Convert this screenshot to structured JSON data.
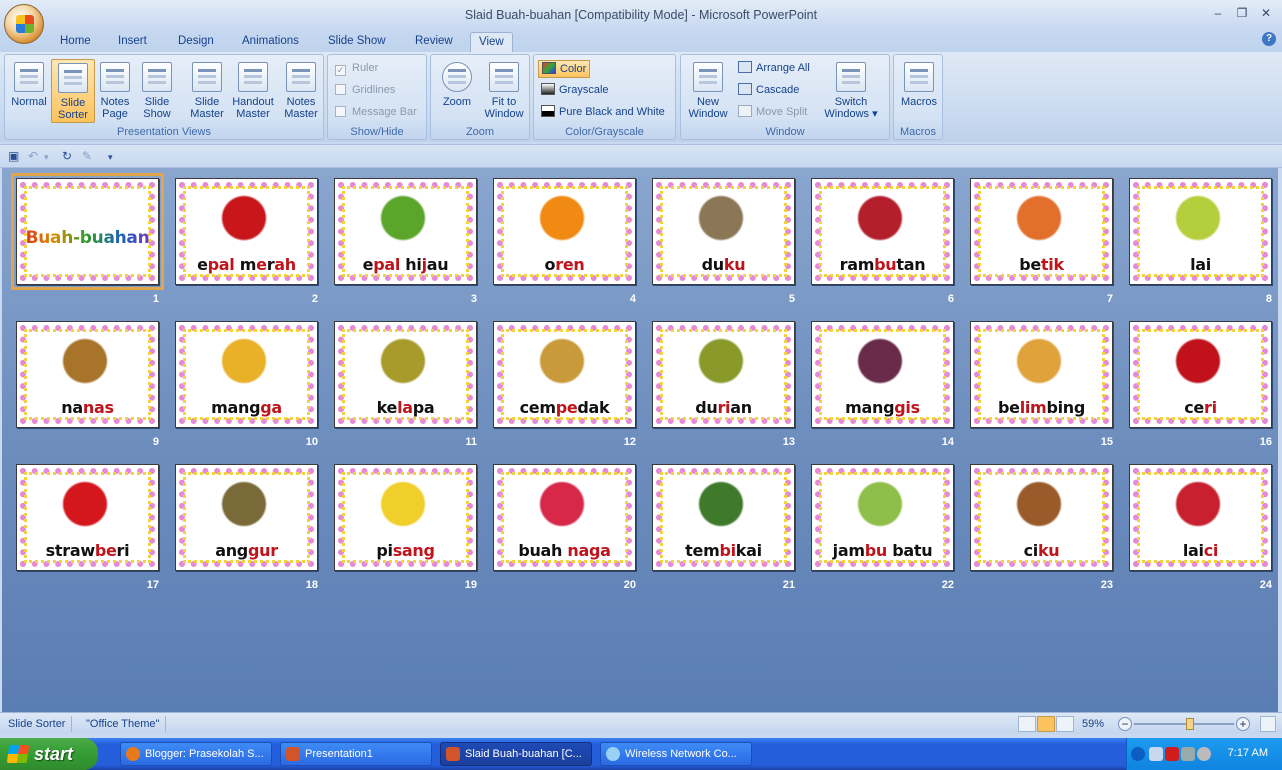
{
  "window": {
    "title": "Slaid Buah-buahan [Compatibility Mode] - Microsoft PowerPoint"
  },
  "tabs": [
    {
      "label": "Home"
    },
    {
      "label": "Insert"
    },
    {
      "label": "Design"
    },
    {
      "label": "Animations"
    },
    {
      "label": "Slide Show"
    },
    {
      "label": "Review"
    },
    {
      "label": "View"
    }
  ],
  "ribbon": {
    "presentation_views": {
      "label": "Presentation Views",
      "normal": "Normal",
      "slide_sorter": "Slide Sorter",
      "notes_page": "Notes Page",
      "slide_show": "Slide Show",
      "slide_master": "Slide Master",
      "handout_master": "Handout Master",
      "notes_master": "Notes Master"
    },
    "show_hide": {
      "label": "Show/Hide",
      "ruler": "Ruler",
      "gridlines": "Gridlines",
      "message_bar": "Message Bar"
    },
    "zoom": {
      "label": "Zoom",
      "zoom": "Zoom",
      "fit": "Fit to Window"
    },
    "color": {
      "label": "Color/Grayscale",
      "color": "Color",
      "grayscale": "Grayscale",
      "pure": "Pure Black and White"
    },
    "window": {
      "label": "Window",
      "new_window": "New Window",
      "arrange_all": "Arrange All",
      "cascade": "Cascade",
      "move_split": "Move Split",
      "switch_windows": "Switch Windows"
    },
    "macros": {
      "label": "Macros",
      "macros": "Macros"
    }
  },
  "slides": [
    {
      "n": "1",
      "title": "Buah-buahan"
    },
    {
      "n": "2",
      "parts": [
        "e",
        "pal ",
        "m",
        "e",
        "r",
        "ah"
      ],
      "pic": "#c8161b"
    },
    {
      "n": "3",
      "parts": [
        "e",
        "pal ",
        "hi",
        "j",
        "au"
      ],
      "pic": "#5aa52a"
    },
    {
      "n": "4",
      "parts": [
        "o",
        "ren"
      ],
      "pic": "#f08a12"
    },
    {
      "n": "5",
      "parts": [
        "du",
        "ku"
      ],
      "pic": "#8b7755"
    },
    {
      "n": "6",
      "parts": [
        "ram",
        "bu",
        "tan"
      ],
      "pic": "#b3202b"
    },
    {
      "n": "7",
      "parts": [
        "be",
        "tik"
      ],
      "pic": "#e2702c"
    },
    {
      "n": "8",
      "parts": [
        "lai"
      ],
      "pic": "#b5cf3c"
    },
    {
      "n": "9",
      "parts": [
        "na",
        "nas"
      ],
      "pic": "#a8742a"
    },
    {
      "n": "10",
      "parts": [
        "mang",
        "ga"
      ],
      "pic": "#e9b128"
    },
    {
      "n": "11",
      "parts": [
        "ke",
        "la",
        "pa"
      ],
      "pic": "#a99a2c"
    },
    {
      "n": "12",
      "parts": [
        "cem",
        "pe",
        "dak"
      ],
      "pic": "#c99a3a"
    },
    {
      "n": "13",
      "parts": [
        "du",
        "ri",
        "an"
      ],
      "pic": "#8a9a2a"
    },
    {
      "n": "14",
      "parts": [
        "mang",
        "gis"
      ],
      "pic": "#6a2a4a"
    },
    {
      "n": "15",
      "parts": [
        "be",
        "lim",
        "bing"
      ],
      "pic": "#e0a23a"
    },
    {
      "n": "16",
      "parts": [
        "ce",
        "ri"
      ],
      "pic": "#c1121c"
    },
    {
      "n": "17",
      "parts": [
        "straw",
        "be",
        "ri"
      ],
      "pic": "#d4161d"
    },
    {
      "n": "18",
      "parts": [
        "ang",
        "gur"
      ],
      "pic": "#7a6a3a"
    },
    {
      "n": "19",
      "parts": [
        "pi",
        "sang"
      ],
      "pic": "#f0cf2a"
    },
    {
      "n": "20",
      "parts": [
        "buah ",
        "naga"
      ],
      "pic": "#d8284a"
    },
    {
      "n": "21",
      "parts": [
        "tem",
        "bi",
        "kai"
      ],
      "pic": "#3f7a2a"
    },
    {
      "n": "22",
      "parts": [
        "jam",
        "bu ",
        "batu"
      ],
      "pic": "#8fbf4a"
    },
    {
      "n": "23",
      "parts": [
        "ci",
        "ku"
      ],
      "pic": "#9a5a2a"
    },
    {
      "n": "24",
      "parts": [
        "lai",
        "ci"
      ],
      "pic": "#c8202e"
    }
  ],
  "status": {
    "view": "Slide Sorter",
    "theme": "\"Office Theme\"",
    "zoom": "59%"
  },
  "zoom_level": 0.59,
  "taskbar": {
    "start": "start",
    "items": [
      "Blogger: Prasekolah S...",
      "Presentation1",
      "Slaid Buah-buahan [C...",
      "Wireless Network Co..."
    ],
    "clock": "7:17 AM"
  }
}
